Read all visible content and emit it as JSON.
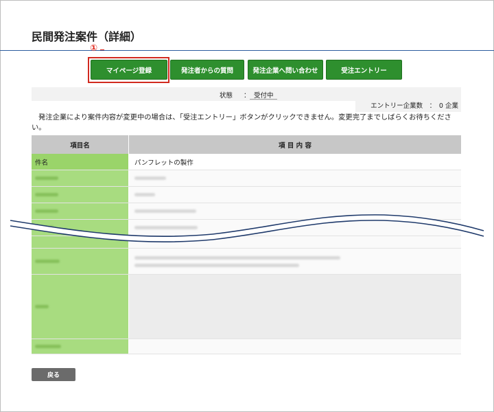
{
  "page": {
    "title": "民間発注案件（詳細）"
  },
  "callout": {
    "number": "①"
  },
  "buttons": {
    "mypage": "マイページ登録",
    "question": "発注者からの質問",
    "inquiry": "発注企業へ問い合わせ",
    "entry": "受注エントリー"
  },
  "status": {
    "label": "状態",
    "colon": "：",
    "value": "受付中"
  },
  "entry_count": {
    "text": "エントリー企業数　：　0 企業"
  },
  "notice": {
    "text": "発注企業により案件内容が変更中の場合は、「受注エントリー」ボタンがクリックできません。変更完了までしばらくお待ちください。"
  },
  "table": {
    "header": {
      "col1": "項目名",
      "col2": "項 目 内 容"
    },
    "rows": [
      {
        "label": "件名",
        "value": "パンフレットの製作"
      }
    ]
  },
  "colors": {
    "button_green": "#2e8f2e",
    "label_green": "#9ad46a",
    "highlight_red": "#d12a1f",
    "title_rule_blue": "#2b5c9e",
    "wave_navy": "#1f3a6b"
  },
  "footer": {
    "back": "戻る"
  }
}
